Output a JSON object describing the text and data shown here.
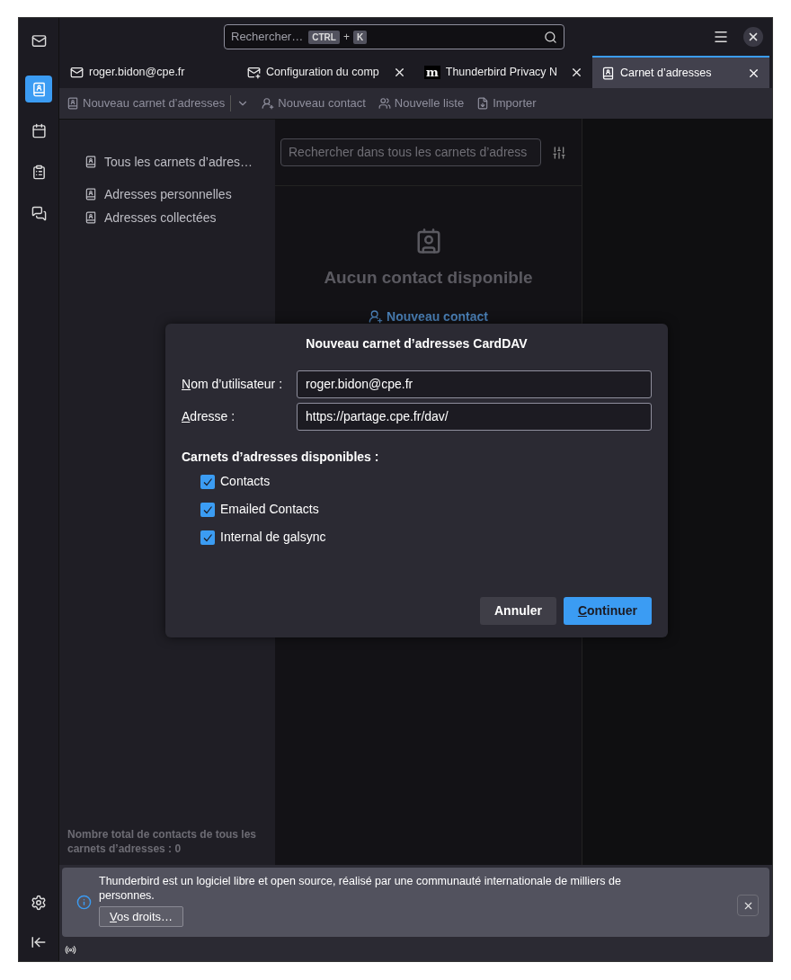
{
  "search": {
    "placeholder": "Rechercher…",
    "keys": [
      "CTRL",
      "K"
    ],
    "joiner": "+"
  },
  "spaces": [
    {
      "kind": "mail",
      "selected": false
    },
    {
      "kind": "addressbook",
      "selected": true
    },
    {
      "kind": "calendar",
      "selected": false
    },
    {
      "kind": "tasks",
      "selected": false
    },
    {
      "kind": "chat",
      "selected": false
    }
  ],
  "tabs": [
    {
      "label": "roger.bidon@cpe.fr",
      "kind": "mail",
      "selected": false,
      "closable": false
    },
    {
      "label": "Configuration du comp",
      "kind": "account",
      "selected": false,
      "closable": true
    },
    {
      "label": "Thunderbird Privacy N",
      "kind": "web",
      "logo_text": "m",
      "selected": false,
      "closable": true
    },
    {
      "label": "Carnet d’adresses",
      "kind": "addressbook",
      "selected": true,
      "closable": true
    }
  ],
  "toolbar": [
    {
      "label": "Nouveau carnet d’adresses",
      "kind": "book",
      "dropdown": true
    },
    {
      "label": "Nouveau contact",
      "kind": "contact",
      "dropdown": false
    },
    {
      "label": "Nouvelle liste",
      "kind": "list",
      "dropdown": false
    },
    {
      "label": "Importer",
      "kind": "import",
      "dropdown": false
    }
  ],
  "sidebar": {
    "items": [
      {
        "label": "Tous les carnets d’adres…"
      },
      {
        "label": "Adresses personnelles"
      },
      {
        "label": "Adresses collectées"
      }
    ],
    "footer": "Nombre total de contacts de tous les carnets d’adresses : 0"
  },
  "list": {
    "search_placeholder": "Rechercher dans tous les carnets d’adress",
    "empty_title": "Aucun contact disponible",
    "empty_action": "Nouveau contact"
  },
  "dialog": {
    "title": "Nouveau carnet d’adresses CardDAV",
    "fields": [
      {
        "label": "Nom d’utilisateur :",
        "value": "roger.bidon@cpe.fr"
      },
      {
        "label": "Adresse :",
        "value": "https://partage.cpe.fr/dav/"
      }
    ],
    "section_title": "Carnets d’adresses disponibles :",
    "books": [
      {
        "label": "Contacts",
        "checked": true
      },
      {
        "label": "Emailed Contacts",
        "checked": true
      },
      {
        "label": "Internal de galsync",
        "checked": true
      }
    ],
    "buttons": [
      {
        "label": "Annuler",
        "kind": "secondary"
      },
      {
        "label": "Continuer",
        "kind": "primary"
      }
    ]
  },
  "notification": {
    "text": "Thunderbird est un logiciel libre et open source, réalisé par une communauté internationale de milliers de personnes.",
    "button": "Vos droits…"
  }
}
